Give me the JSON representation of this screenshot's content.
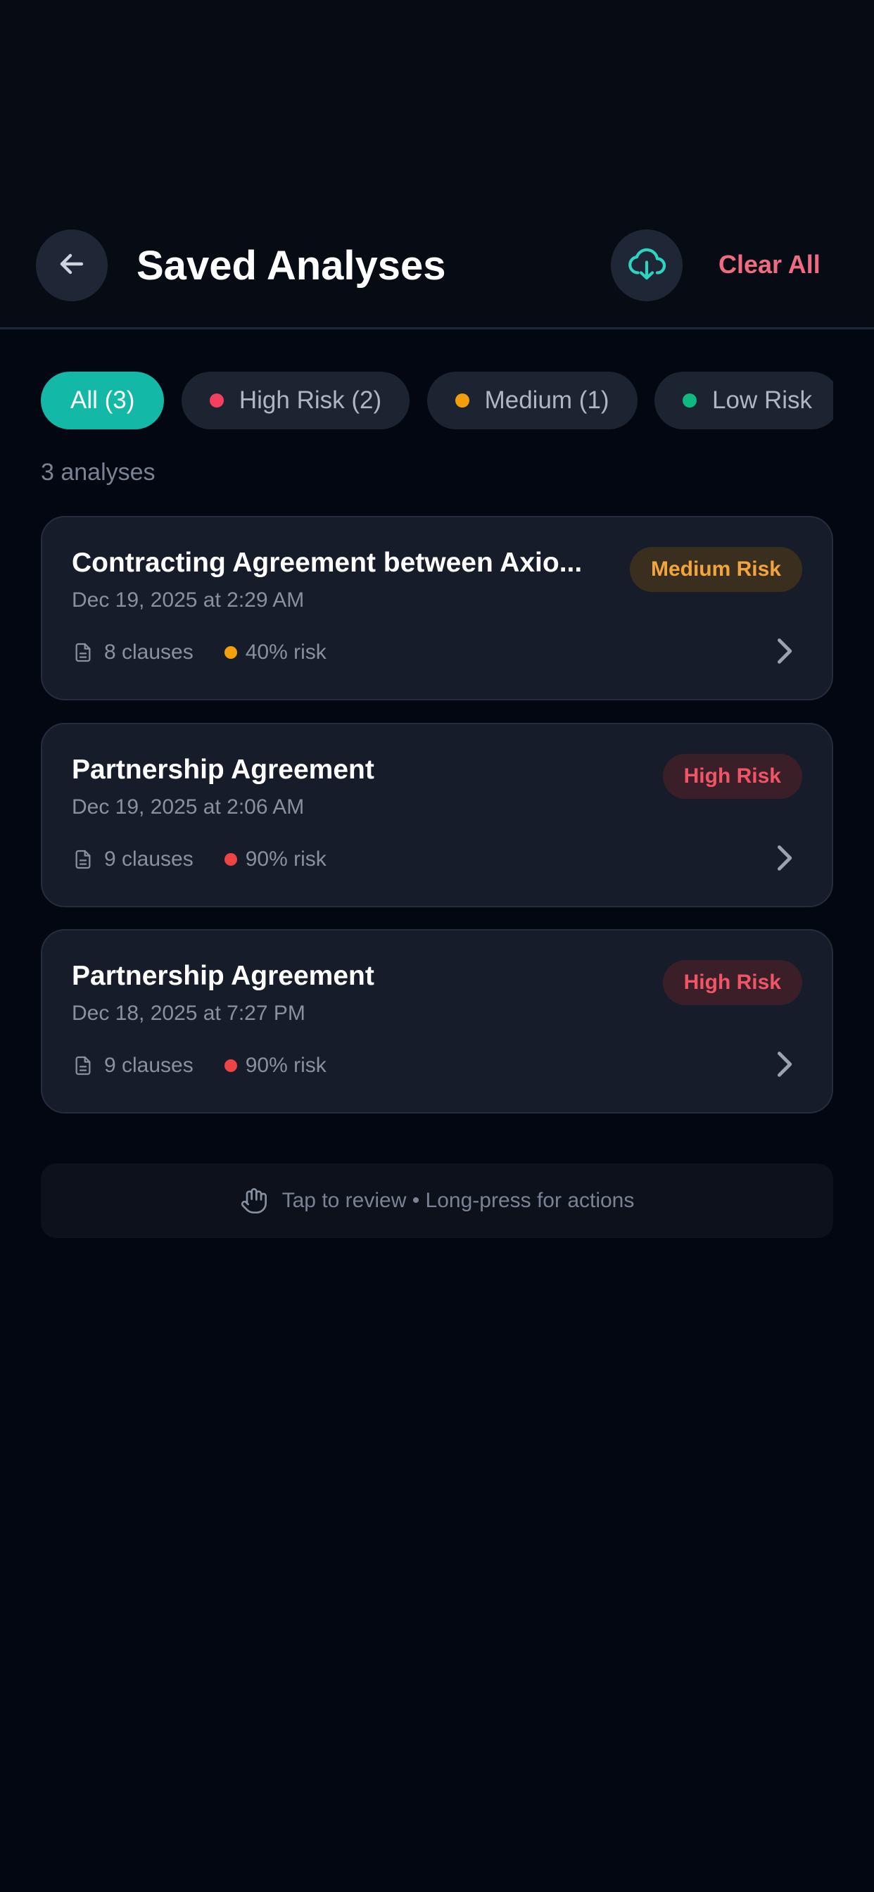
{
  "header": {
    "title": "Saved Analyses",
    "clear_all_label": "Clear All",
    "back_icon": "arrow-left-icon",
    "cloud_icon": "cloud-download-icon"
  },
  "filters": [
    {
      "label": "All (3)",
      "active": true,
      "dot_color": null
    },
    {
      "label": "High Risk (2)",
      "active": false,
      "dot_color": "#f43f5e"
    },
    {
      "label": "Medium (1)",
      "active": false,
      "dot_color": "#f59e0b"
    },
    {
      "label": "Low Risk",
      "active": false,
      "dot_color": "#10b981"
    }
  ],
  "summary": {
    "count_text": "3 analyses"
  },
  "cards": [
    {
      "title": "Contracting Agreement between Axio...",
      "date": "Dec 19, 2025 at 2:29 AM",
      "badge": "Medium Risk",
      "badge_level": "medium",
      "clauses": "8 clauses",
      "risk": "40% risk",
      "risk_color": "#f59e0b"
    },
    {
      "title": "Partnership Agreement",
      "date": "Dec 19, 2025 at 2:06 AM",
      "badge": "High Risk",
      "badge_level": "high",
      "clauses": "9 clauses",
      "risk": "90% risk",
      "risk_color": "#ef4444"
    },
    {
      "title": "Partnership Agreement",
      "date": "Dec 18, 2025 at 7:27 PM",
      "badge": "High Risk",
      "badge_level": "high",
      "clauses": "9 clauses",
      "risk": "90% risk",
      "risk_color": "#ef4444"
    }
  ],
  "hint": {
    "text": "Tap to review • Long-press for actions",
    "icon": "hand-icon"
  },
  "colors": {
    "accent": "#14b8a6",
    "danger": "#f06b82",
    "background": "#030712"
  }
}
